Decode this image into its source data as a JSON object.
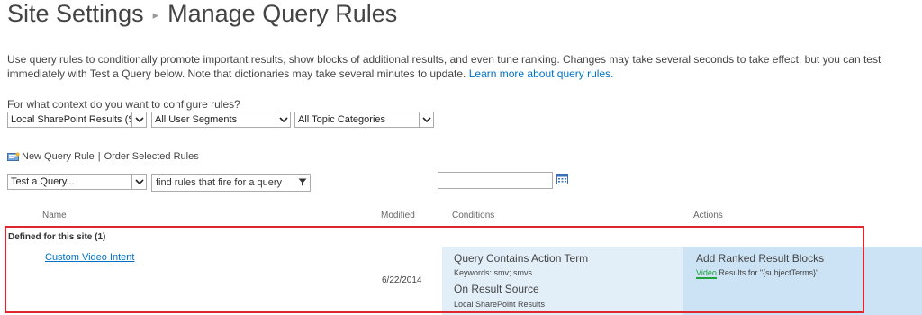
{
  "header": {
    "breadcrumb_root": "Site Settings",
    "page_title": "Manage Query Rules"
  },
  "intro": {
    "text": "Use query rules to conditionally promote important results, show blocks of additional results, and even tune ranking. Changes may take several seconds to take effect, but you can test immediately with Test a Query below. Note that dictionaries may take several minutes to update.",
    "link": "Learn more about query rules."
  },
  "context": {
    "label": "For what context do you want to configure rules?",
    "source_value": "Local SharePoint Results (Syste",
    "segments_value": "All User Segments",
    "topics_value": "All Topic Categories"
  },
  "toolbar": {
    "new_rule": "New Query Rule",
    "order_rules": "Order Selected Rules"
  },
  "test": {
    "query_value": "Test a Query...",
    "filter_value": "find rules that fire for a query"
  },
  "table": {
    "headers": {
      "name": "Name",
      "modified": "Modified",
      "conditions": "Conditions",
      "actions": "Actions"
    },
    "group_label": "Defined for this site (1)",
    "rows": [
      {
        "name": "Custom Video Intent",
        "modified": "6/22/2014",
        "conditions": [
          {
            "title": "Query Contains Action Term",
            "detail": "Keywords: smv; smvs"
          },
          {
            "title": "On Result Source",
            "detail": "Local SharePoint Results"
          }
        ],
        "action_title": "Add Ranked Result Blocks",
        "action_link": "Video",
        "action_detail": "Results for \"{subjectTerms}\""
      }
    ]
  },
  "colors": {
    "link": "#0072c6",
    "conditions_band": "#e2eff9",
    "actions_band": "#cbe3f5",
    "highlight": "#e0262e",
    "action_link": "#22a33a"
  }
}
